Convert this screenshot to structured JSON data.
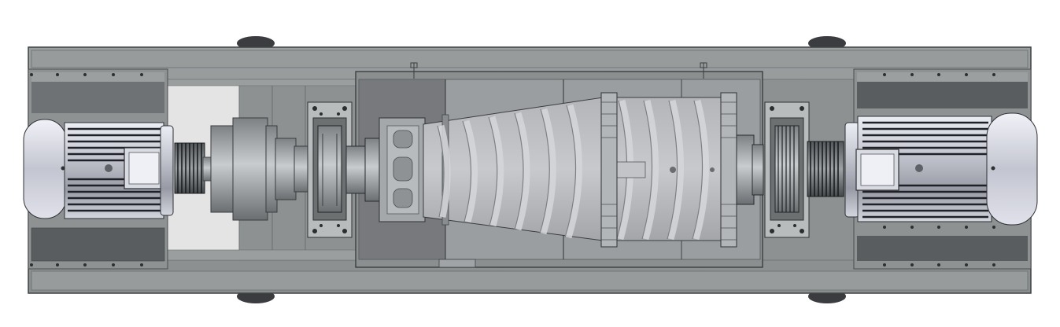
{
  "view": "top-view",
  "colors": {
    "background": "#ffffff",
    "frame": "#8f9394",
    "frame_dark": "#5f6364",
    "frame_light": "#b4b8b9",
    "motor_body": "#c4c6cf",
    "motor_fins_dark": "#2b2d33",
    "motor_cap": "#d6d7e0",
    "bowl_glass": "#a7a9ad",
    "screw": "#c9cacd",
    "metal": "#9ea2a4"
  },
  "icons": {
    "left_motor": "electric-motor-icon",
    "right_motor": "electric-motor-icon",
    "decanter_bowl": "decanter-bowl-icon",
    "screw_conveyor": "screw-conveyor-icon"
  }
}
